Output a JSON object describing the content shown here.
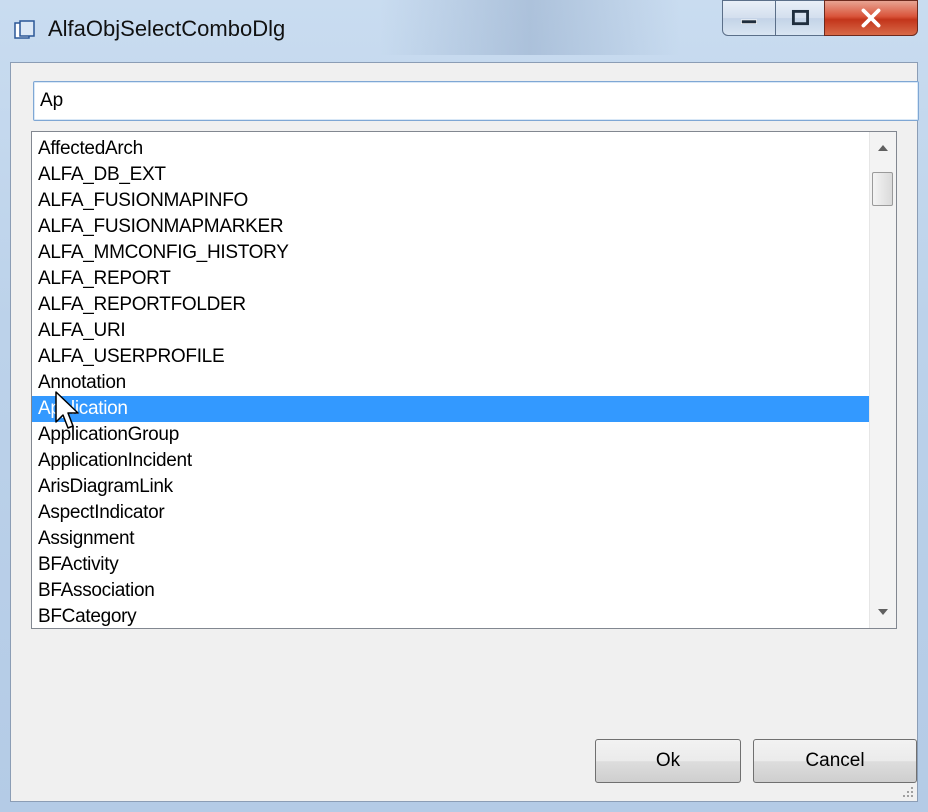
{
  "window": {
    "title": "AlfaObjSelectComboDlg",
    "icons": {
      "app": "window-icon",
      "minimize": "minimize-icon",
      "maximize": "maximize-icon",
      "close": "close-icon"
    }
  },
  "search": {
    "value": "Ap"
  },
  "list": {
    "items": [
      "AffectedArch",
      "ALFA_DB_EXT",
      "ALFA_FUSIONMAPINFO",
      "ALFA_FUSIONMAPMARKER",
      "ALFA_MMCONFIG_HISTORY",
      "ALFA_REPORT",
      "ALFA_REPORTFOLDER",
      "ALFA_URI",
      "ALFA_USERPROFILE",
      "Annotation",
      "Application",
      "ApplicationGroup",
      "ApplicationIncident",
      "ArisDiagramLink",
      "AspectIndicator",
      "Assignment",
      "BFActivity",
      "BFAssociation",
      "BFCategory"
    ],
    "selected": "Application"
  },
  "buttons": {
    "ok": "Ok",
    "cancel": "Cancel"
  },
  "colors": {
    "selection": "#3399ff",
    "frame": "#bcd2ea",
    "close_button": "#c3351b"
  }
}
